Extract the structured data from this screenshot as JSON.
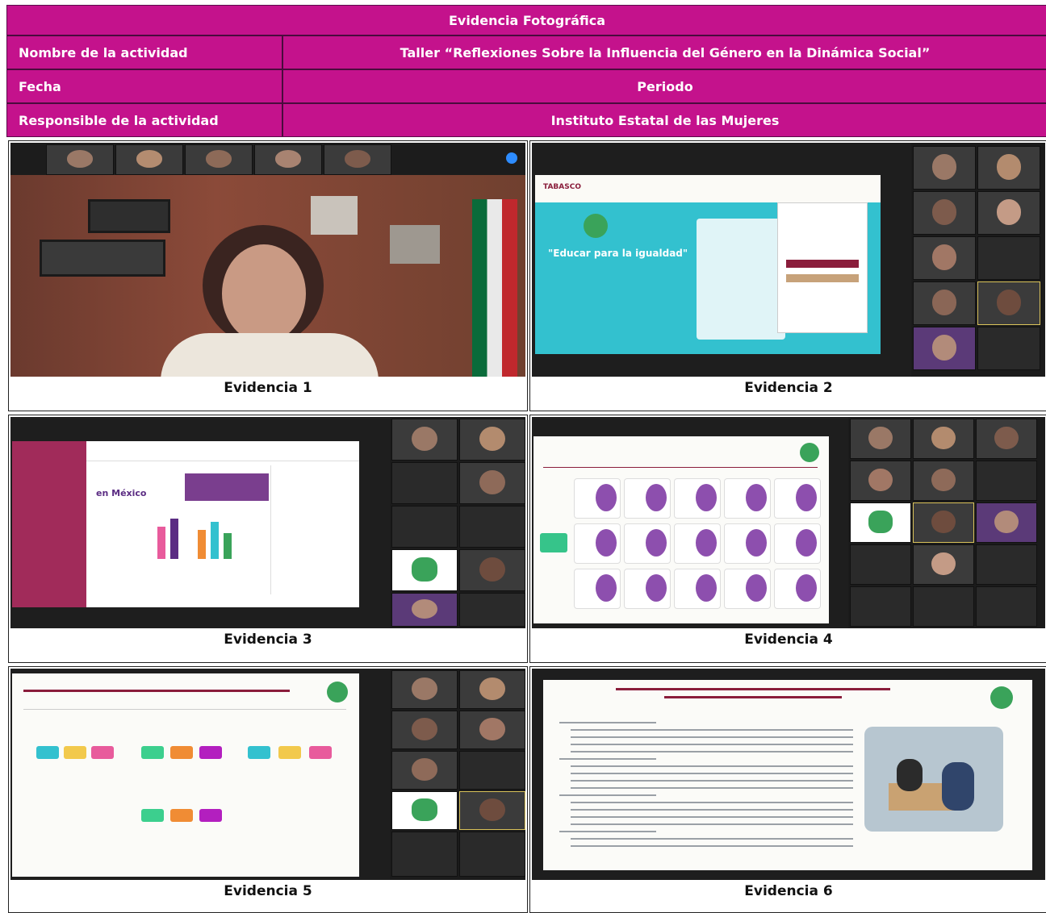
{
  "header": {
    "title": "Evidencia Fotográfica",
    "rows": [
      {
        "label": "Nombre de la actividad",
        "value": "Taller “Reflexiones Sobre la Influencia del Género en la Dinámica Social”"
      },
      {
        "label": "Fecha",
        "value": "Periodo"
      },
      {
        "label": "Responsible de la actividad",
        "value": "Instituto Estatal de las Mujeres"
      }
    ]
  },
  "evidencias": [
    {
      "caption": "Evidencia 1"
    },
    {
      "caption": "Evidencia 2"
    },
    {
      "caption": "Evidencia 3"
    },
    {
      "caption": "Evidencia 4"
    },
    {
      "caption": "Evidencia 5"
    },
    {
      "caption": "Evidencia 6"
    }
  ],
  "slide2": {
    "brand": "TABASCO",
    "subtitle": "\"Educar para la igualdad\""
  },
  "slide3": {
    "heading": "en México"
  },
  "colors": {
    "header_bg": "#c4128c",
    "header_border": "#4a0b3d",
    "accent_pink": "#a12b5a",
    "teal": "#33c1cf"
  }
}
